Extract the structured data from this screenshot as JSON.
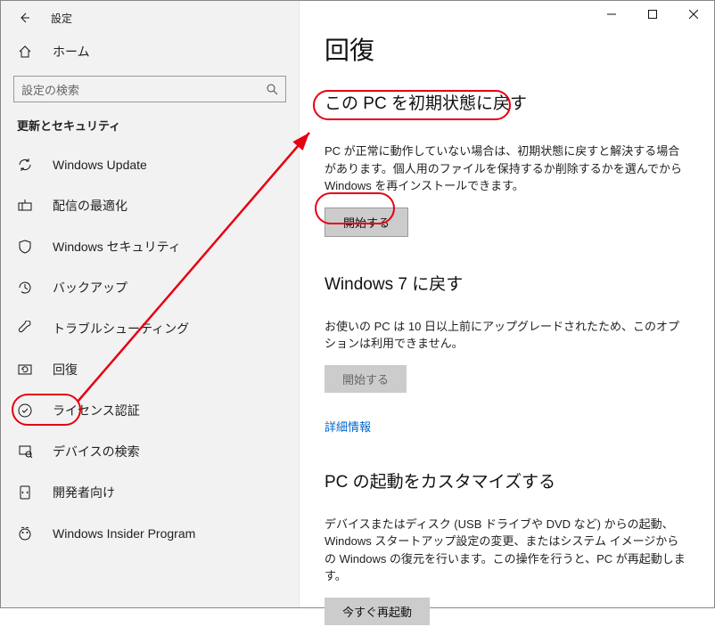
{
  "window": {
    "title": "設定"
  },
  "home": {
    "label": "ホーム"
  },
  "search": {
    "placeholder": "設定の検索"
  },
  "section": {
    "header": "更新とセキュリティ"
  },
  "nav": {
    "items": [
      {
        "label": "Windows Update"
      },
      {
        "label": "配信の最適化"
      },
      {
        "label": "Windows セキュリティ"
      },
      {
        "label": "バックアップ"
      },
      {
        "label": "トラブルシューティング"
      },
      {
        "label": "回復"
      },
      {
        "label": "ライセンス認証"
      },
      {
        "label": "デバイスの検索"
      },
      {
        "label": "開発者向け"
      },
      {
        "label": "Windows Insider Program"
      }
    ]
  },
  "main": {
    "heading": "回復",
    "reset": {
      "title": "この PC を初期状態に戻す",
      "desc": "PC が正常に動作していない場合は、初期状態に戻すと解決する場合があります。個人用のファイルを保持するか削除するかを選んでから Windows を再インストールできます。",
      "button": "開始する"
    },
    "goback": {
      "title": "Windows 7 に戻す",
      "desc": "お使いの PC は 10 日以上前にアップグレードされたため、このオプションは利用できません。",
      "button": "開始する",
      "link": "詳細情報"
    },
    "advanced": {
      "title": "PC の起動をカスタマイズする",
      "desc": "デバイスまたはディスク (USB ドライブや DVD など) からの起動、Windows スタートアップ設定の変更、またはシステム イメージからの Windows の復元を行います。この操作を行うと、PC が再起動します。",
      "button": "今すぐ再起動"
    }
  }
}
